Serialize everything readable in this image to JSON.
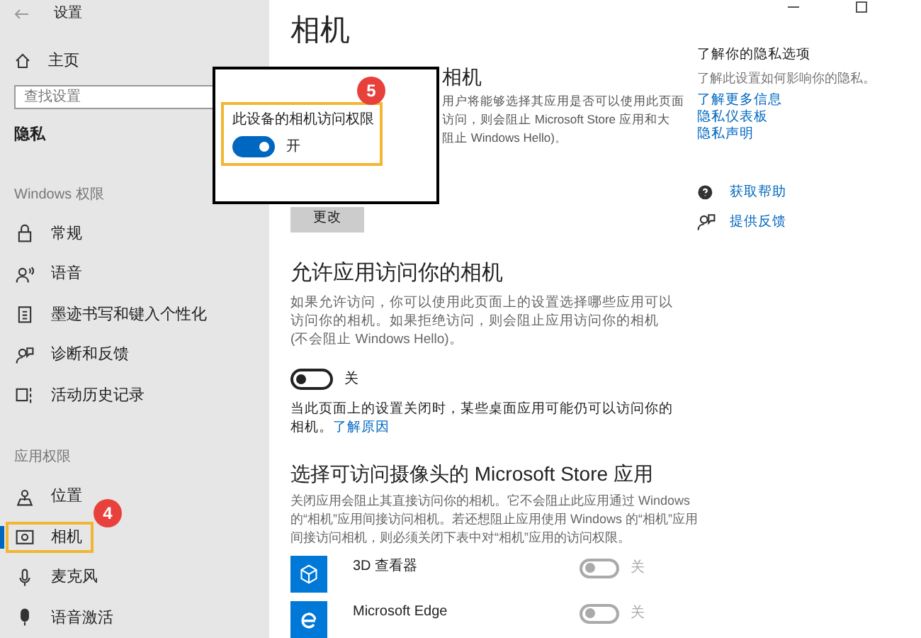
{
  "window": {
    "title": "设置"
  },
  "sidebar": {
    "home": "主页",
    "search": {
      "placeholder": "查找设置"
    },
    "section_title": "隐私",
    "groups": [
      {
        "title": "Windows 权限",
        "items": [
          {
            "label": "常规",
            "selected": false,
            "highlighted": false
          },
          {
            "label": "语音",
            "selected": false,
            "highlighted": false
          },
          {
            "label": "墨迹书写和键入个性化",
            "selected": false,
            "highlighted": false
          },
          {
            "label": "诊断和反馈",
            "selected": false,
            "highlighted": false
          },
          {
            "label": "活动历史记录",
            "selected": false,
            "highlighted": false
          }
        ]
      },
      {
        "title": "应用权限",
        "items": [
          {
            "label": "位置",
            "selected": false,
            "highlighted": false
          },
          {
            "label": "相机",
            "selected": true,
            "highlighted": true,
            "step": "4"
          },
          {
            "label": "麦克风",
            "selected": false,
            "highlighted": false
          },
          {
            "label": "语音激活",
            "selected": false,
            "highlighted": false
          }
        ]
      }
    ]
  },
  "main": {
    "title": "相机",
    "device_section": {
      "heading": "相机",
      "description": [
        "用户将能够选择其应用是否可以使用此页面",
        "访问，则会阻止 Microsoft Store 应用和大",
        "阻止 Windows Hello)。"
      ],
      "button": "更改"
    },
    "popup": {
      "step": "5",
      "label": "此设备的相机访问权限",
      "on": true,
      "state_text": "开"
    },
    "allow_section": {
      "heading": "允许应用访问你的相机",
      "description": "如果允许访问，你可以使用此页面上的设置选择哪些应用可以访问你的相机。如果拒绝访问，则会阻止应用访问你的相机(不会阻止 Windows Hello)。",
      "on": false,
      "state_text": "关",
      "note": "当此页面上的设置关闭时，某些桌面应用可能仍可以访问你的相机。",
      "note_link": "了解原因"
    },
    "store_section": {
      "heading": "选择可访问摄像头的 Microsoft Store 应用",
      "description": "关闭应用会阻止其直接访问你的相机。它不会阻止此应用通过 Windows 的“相机”应用间接访问相机。若还想阻止应用使用 Windows 的“相机”应用间接访问相机，则必须关闭下表中对“相机”应用的访问权限。",
      "apps": [
        {
          "name": "3D 查看器",
          "on": false,
          "state_text": "关"
        },
        {
          "name": "Microsoft Edge",
          "on": false,
          "state_text": "关"
        }
      ]
    }
  },
  "aside": {
    "heading": "了解你的隐私选项",
    "description": "了解此设置如何影响你的隐私。",
    "links": [
      "了解更多信息",
      "隐私仪表板",
      "隐私声明"
    ],
    "actions": [
      {
        "label": "获取帮助"
      },
      {
        "label": "提供反馈"
      }
    ]
  }
}
